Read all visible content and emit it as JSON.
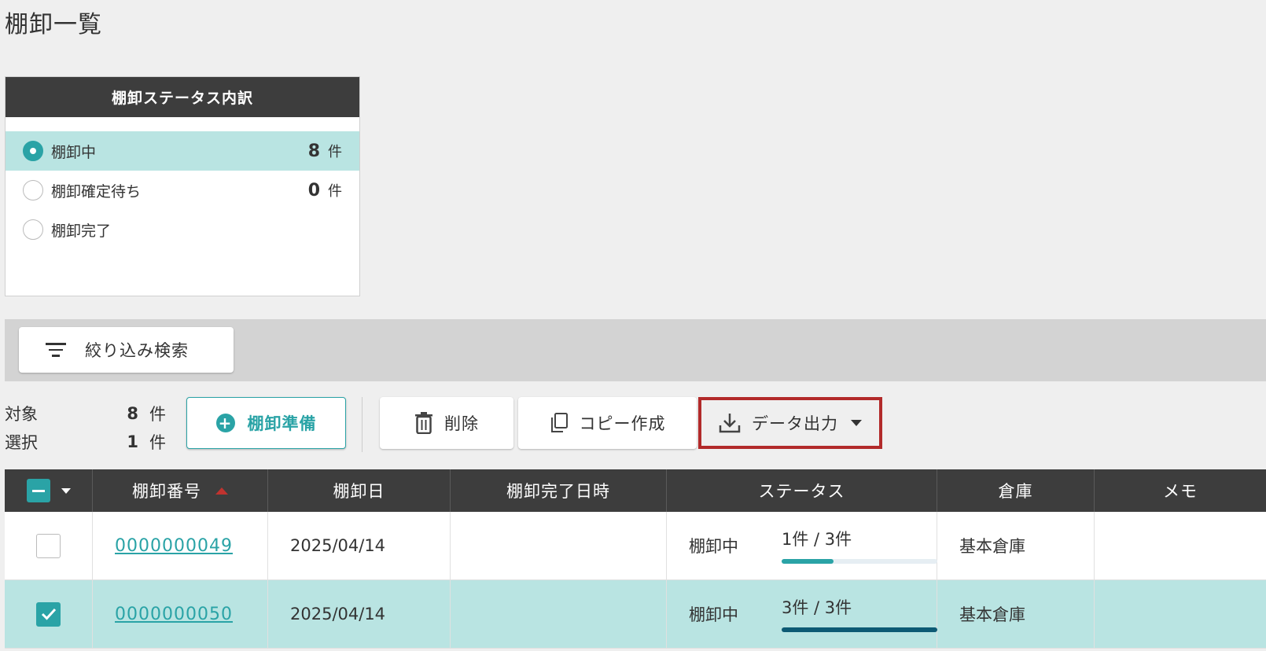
{
  "page": {
    "title": "棚卸一覧"
  },
  "status_panel": {
    "title": "棚卸ステータス内訳",
    "items": [
      {
        "label": "棚卸中",
        "count": "8",
        "unit": "件",
        "selected": true
      },
      {
        "label": "棚卸確定待ち",
        "count": "0",
        "unit": "件",
        "selected": false
      },
      {
        "label": "棚卸完了",
        "count": "",
        "unit": "",
        "selected": false
      }
    ]
  },
  "filter": {
    "button_label": "絞り込み検索",
    "icon": "filter-icon"
  },
  "summary": {
    "target_label": "対象",
    "target_count": "8",
    "target_unit": "件",
    "selected_label": "選択",
    "selected_count": "1",
    "selected_unit": "件"
  },
  "toolbar": {
    "prepare_label": "棚卸準備",
    "delete_label": "削除",
    "copy_label": "コピー作成",
    "export_label": "データ出力"
  },
  "table": {
    "columns": [
      "棚卸番号",
      "棚卸日",
      "棚卸完了日時",
      "ステータス",
      "倉庫",
      "メモ"
    ],
    "rows": [
      {
        "checked": false,
        "number": "0000000049",
        "date": "2025/04/14",
        "completed_at": "",
        "status": "棚卸中",
        "progress_text": "1件 / 3件",
        "progress": 0.333,
        "progress_color": "#2aa3a6",
        "warehouse": "基本倉庫",
        "memo": ""
      },
      {
        "checked": true,
        "number": "0000000050",
        "date": "2025/04/14",
        "completed_at": "",
        "status": "棚卸中",
        "progress_text": "3件 / 3件",
        "progress": 1.0,
        "progress_color": "#0d5a74",
        "warehouse": "基本倉庫",
        "memo": ""
      }
    ]
  },
  "colors": {
    "accent": "#2aa3a6",
    "highlight": "#b22a2a",
    "header_bg": "#3d3d3d",
    "selected_row": "#b9e4e2"
  }
}
